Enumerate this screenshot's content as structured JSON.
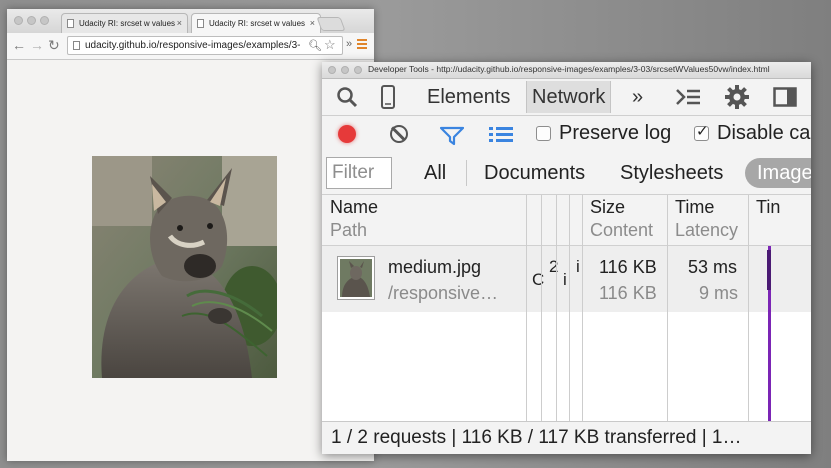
{
  "browser": {
    "tabs": [
      {
        "title": "Udacity RI: srcset w values",
        "close": "×"
      },
      {
        "title": "Udacity RI: srcset w values",
        "close": "×"
      }
    ],
    "nav": {
      "back": "←",
      "forward": "→",
      "reload": "↻"
    },
    "url": "udacity.github.io/responsive-images/examples/3-...",
    "extensions_label": "»"
  },
  "devtools": {
    "window_title": "Developer Tools - http://udacity.github.io/responsive-images/examples/3-03/srcsetWValues50vw/index.html",
    "panel_tabs": [
      "Elements",
      "Network"
    ],
    "more_tabs": "»",
    "icons": {
      "search": "search-icon",
      "device": "device-mode-icon",
      "console": "console-drawer-icon",
      "settings": "gear-icon",
      "dock": "dock-side-icon"
    },
    "toolbar": {
      "preserve_log": {
        "label": "Preserve log",
        "checked": false
      },
      "disable_cache": {
        "label": "Disable ca",
        "checked": true
      },
      "record_color": "#e63a3a",
      "accent": "#3a84e0"
    },
    "filter": {
      "placeholder": "Filter",
      "types": [
        "All",
        "Documents",
        "Stylesheets",
        "Image"
      ],
      "selected": "Image"
    },
    "columns": [
      {
        "main": "Name",
        "sub": "Path"
      },
      {
        "main": "Size",
        "sub": "Content"
      },
      {
        "main": "Time",
        "sub": "Latency"
      },
      {
        "main": "Tin",
        "sub": ""
      }
    ],
    "rows": [
      {
        "name": "medium.jpg",
        "path": "/responsive…",
        "method_fragment": "C",
        "status_fragment": "2",
        "type_fragment": "i",
        "initiator_fragment": "i",
        "size": "116 KB",
        "content": "116 KB",
        "time": "53 ms",
        "latency": "9 ms"
      }
    ],
    "timeline_color": "#7b25b5",
    "status": "1 / 2 requests | 116 KB / 117 KB transferred | 1…"
  }
}
